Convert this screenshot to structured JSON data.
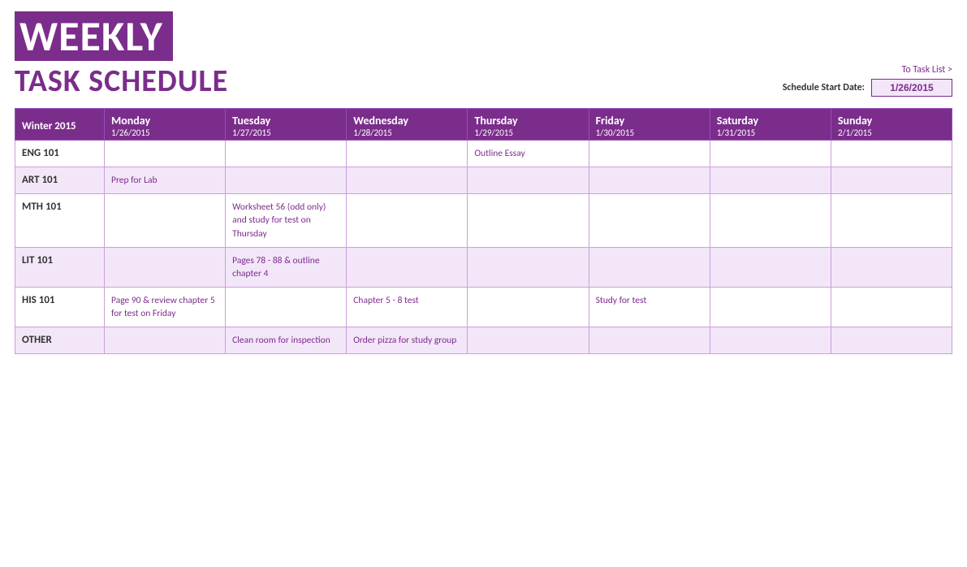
{
  "title": {
    "line1": "WEEKLY",
    "line2": "TASK SCHEDULE"
  },
  "header": {
    "to_task_link": "To Task List >",
    "start_date_label": "Schedule Start Date:",
    "start_date_value": "1/26/2015"
  },
  "columns": [
    {
      "name": "Winter 2015",
      "date": ""
    },
    {
      "name": "Monday",
      "date": "1/26/2015"
    },
    {
      "name": "Tuesday",
      "date": "1/27/2015"
    },
    {
      "name": "Wednesday",
      "date": "1/28/2015"
    },
    {
      "name": "Thursday",
      "date": "1/29/2015"
    },
    {
      "name": "Friday",
      "date": "1/30/2015"
    },
    {
      "name": "Saturday",
      "date": "1/31/2015"
    },
    {
      "name": "Sunday",
      "date": "2/1/2015"
    }
  ],
  "rows": [
    {
      "label": "ENG 101",
      "cells": [
        "",
        "",
        "",
        "Outline Essay",
        "",
        "",
        ""
      ]
    },
    {
      "label": "ART 101",
      "cells": [
        "Prep for Lab",
        "",
        "",
        "",
        "",
        "",
        ""
      ]
    },
    {
      "label": "MTH 101",
      "cells": [
        "",
        "Worksheet 56 (odd only) and study for test on Thursday",
        "",
        "",
        "",
        "",
        ""
      ]
    },
    {
      "label": "LIT 101",
      "cells": [
        "",
        "Pages 78 - 88 & outline chapter 4",
        "",
        "",
        "",
        "",
        ""
      ]
    },
    {
      "label": "HIS 101",
      "cells": [
        "Page 90 & review chapter 5 for test on Friday",
        "",
        "Chapter 5 - 8 test",
        "",
        "Study for test",
        "",
        ""
      ]
    },
    {
      "label": "OTHER",
      "cells": [
        "",
        "Clean room for inspection",
        "Order pizza for study group",
        "",
        "",
        "",
        ""
      ]
    }
  ]
}
